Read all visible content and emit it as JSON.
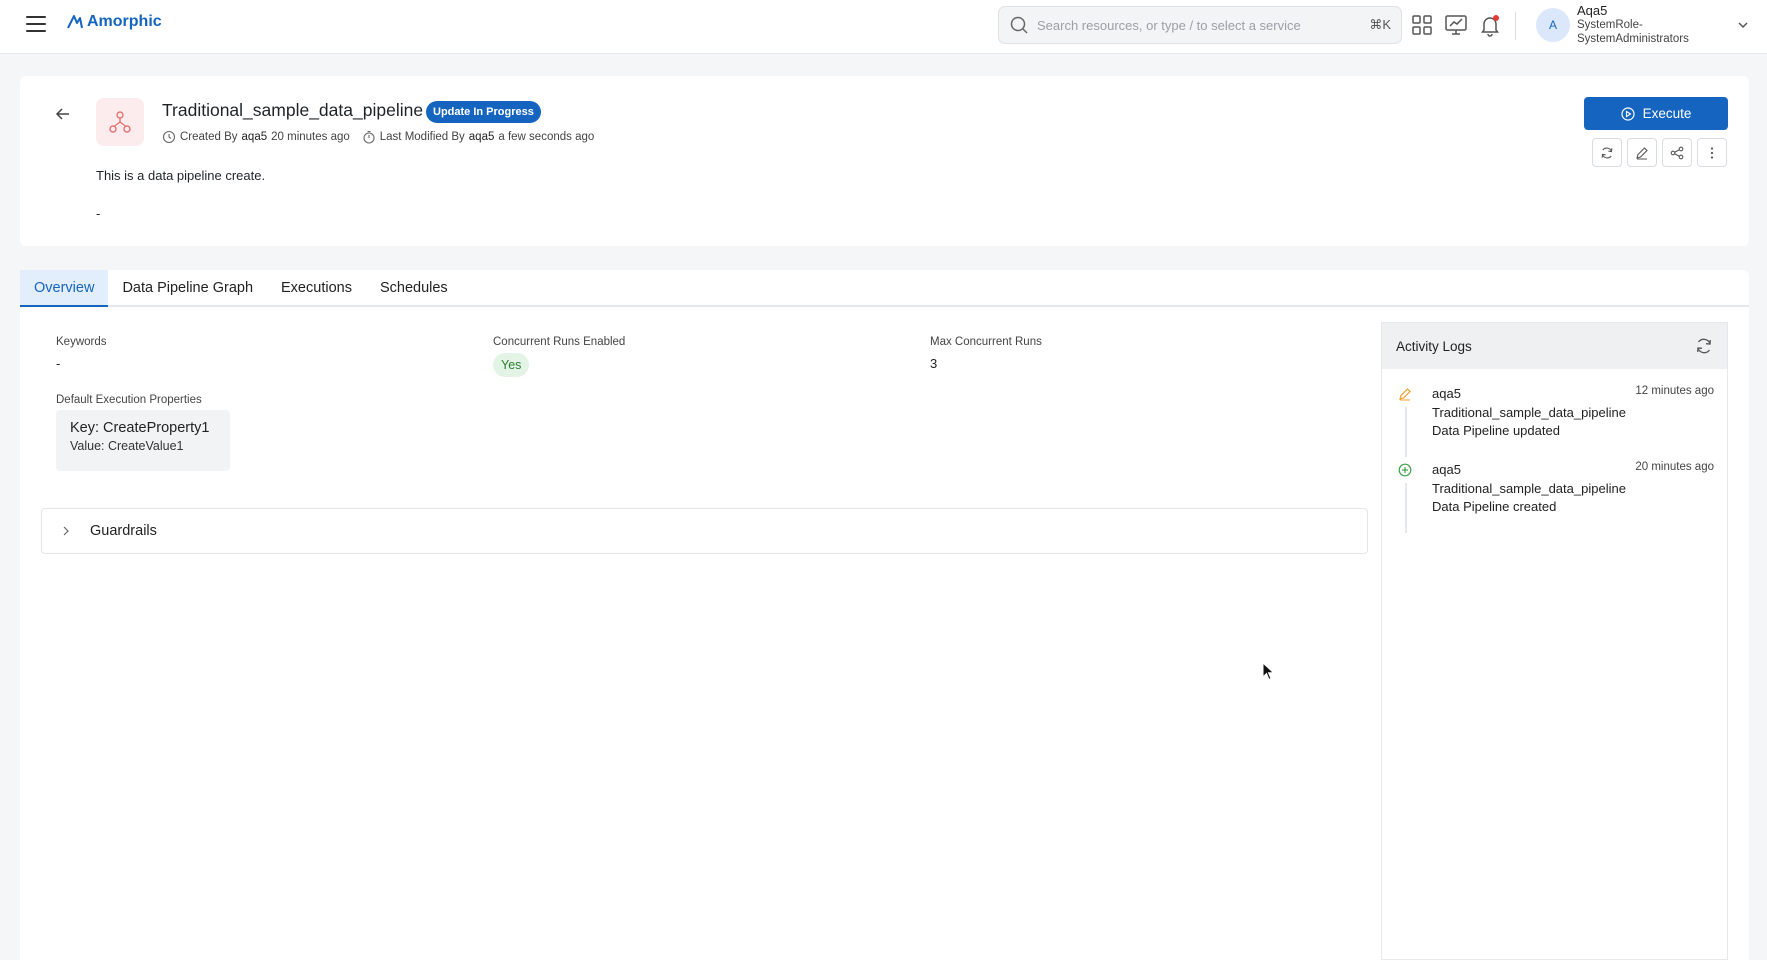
{
  "topbar": {
    "brand": "Amorphic",
    "search_placeholder": "Search resources, or type / to select a service",
    "search_shortcut": "⌘K",
    "icons": [
      "apps-grid-icon",
      "monitor-chart-icon",
      "bell-icon"
    ],
    "user": {
      "initial": "A",
      "name": "Aqa5",
      "role": "SystemRole-SystemAdministrators"
    }
  },
  "header": {
    "title": "Traditional_sample_data_pipeline",
    "status": "Update In Progress",
    "created_by_label": "Created By",
    "created_by_user": "aqa5",
    "created_time": "20 minutes ago",
    "modified_by_label": "Last Modified By",
    "modified_by_user": "aqa5",
    "modified_time": "a few seconds ago",
    "description": "This is a data pipeline create.",
    "extra": "-",
    "execute_label": "Execute",
    "actions": [
      "refresh-icon",
      "edit-icon",
      "share-icon",
      "more-vertical-icon"
    ],
    "status_color": "#1565c0"
  },
  "tabs": [
    {
      "label": "Overview",
      "active": true
    },
    {
      "label": "Data Pipeline Graph",
      "active": false
    },
    {
      "label": "Executions",
      "active": false
    },
    {
      "label": "Schedules",
      "active": false
    }
  ],
  "overview": {
    "keywords_label": "Keywords",
    "keywords_value": "-",
    "concurrent_label": "Concurrent Runs Enabled",
    "concurrent_value": "Yes",
    "max_runs_label": "Max Concurrent Runs",
    "max_runs_value": "3",
    "exec_props_label": "Default Execution Properties",
    "property_key": "Key: CreateProperty1",
    "property_value": "Value: CreateValue1",
    "guardrails_label": "Guardrails"
  },
  "activity": {
    "title": "Activity Logs",
    "items": [
      {
        "user": "aqa5",
        "resource": "Traditional_sample_data_pipeline",
        "action": "Data Pipeline updated",
        "time": "12 minutes ago",
        "icon": "edit-icon"
      },
      {
        "user": "aqa5",
        "resource": "Traditional_sample_data_pipeline",
        "action": "Data Pipeline created",
        "time": "20 minutes ago",
        "icon": "plus-circle-icon"
      }
    ]
  }
}
